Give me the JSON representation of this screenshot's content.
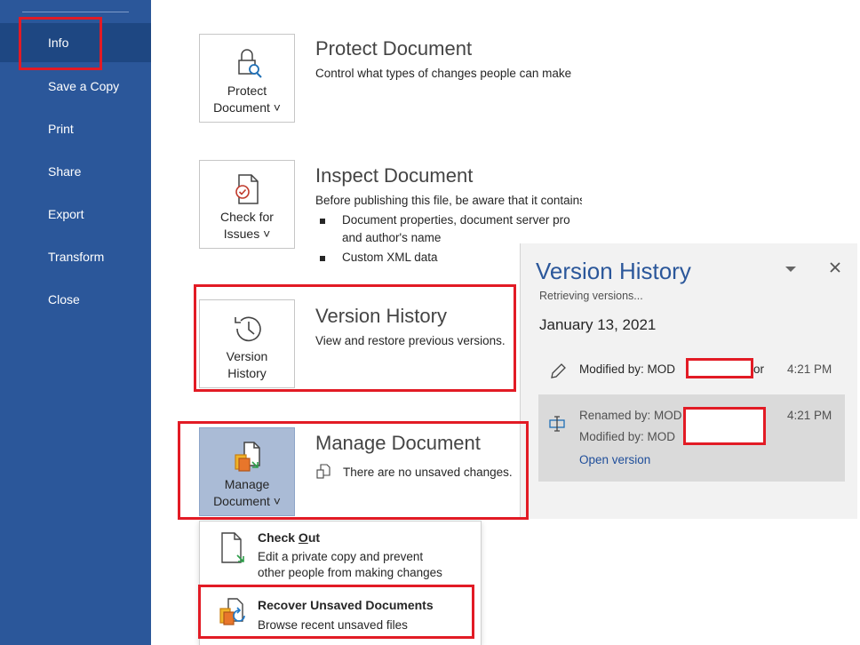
{
  "sidebar": {
    "items": [
      {
        "label": "Info",
        "active": true
      },
      {
        "label": "Save a Copy"
      },
      {
        "label": "Print"
      },
      {
        "label": "Share"
      },
      {
        "label": "Export"
      },
      {
        "label": "Transform"
      },
      {
        "label": "Close"
      }
    ],
    "background": "#2b579a"
  },
  "protect": {
    "tile_line1": "Protect",
    "tile_line2": "Document ˅",
    "title": "Protect Document",
    "desc": "Control what types of changes people can make"
  },
  "inspect": {
    "tile_line1": "Check for",
    "tile_line2": "Issues ˅",
    "title": "Inspect Document",
    "desc": "Before publishing this file, be aware that it contains:",
    "bullets": [
      "Document properties, document server pro",
      "and author's name",
      "Custom XML data"
    ]
  },
  "version": {
    "tile_line1": "Version",
    "tile_line2": "History",
    "title": "Version History",
    "desc": "View and restore previous versions."
  },
  "manage": {
    "tile_line1": "Manage",
    "tile_line2": "Document ˅",
    "title": "Manage Document",
    "desc": "There are no unsaved changes."
  },
  "menu": {
    "checkout_title_pre": "Check ",
    "checkout_title_ul": "O",
    "checkout_title_post": "ut",
    "checkout_desc1": "Edit a private copy and prevent",
    "checkout_desc2": "other people from making changes",
    "recover_title": "Recover Unsaved Documents",
    "recover_desc": "Browse recent unsaved files"
  },
  "version_pane": {
    "title": "Version History",
    "status": "Retrieving versions...",
    "date": "January 13, 2021",
    "entries": [
      {
        "line1": "Modified by: MOD",
        "suffix": "or",
        "time": "4:21 PM"
      },
      {
        "line1": "Renamed by: MOD",
        "line2": "Modified by: MOD",
        "time": "4:21 PM",
        "action": "Open version"
      }
    ]
  },
  "colors": {
    "accent": "#2b579a",
    "annotation": "#e21b25"
  }
}
